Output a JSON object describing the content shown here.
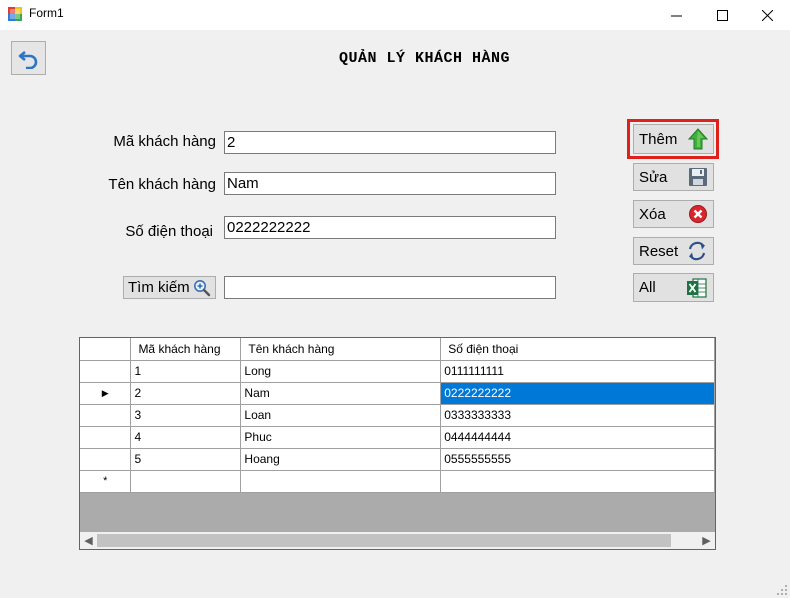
{
  "window": {
    "title": "Form1"
  },
  "heading": "QUẢN LÝ KHÁCH HÀNG",
  "form": {
    "ma_label": "Mã khách hàng",
    "ma_value": "2",
    "ten_label": "Tên khách hàng",
    "ten_value": "Nam",
    "sdt_label": "Số điện thoại",
    "sdt_value": "0222222222",
    "search_button": "Tìm kiếm",
    "search_value": ""
  },
  "buttons": {
    "add": "Thêm",
    "edit": "Sửa",
    "delete": "Xóa",
    "reset": "Reset",
    "all": "All"
  },
  "grid": {
    "columns": [
      "Mã khách hàng",
      "Tên khách hàng",
      "Số điện thoại"
    ],
    "rows": [
      [
        "1",
        "Long",
        "0111111111"
      ],
      [
        "2",
        "Nam",
        "0222222222"
      ],
      [
        "3",
        "Loan",
        "0333333333"
      ],
      [
        "4",
        "Phuc",
        "0444444444"
      ],
      [
        "5",
        "Hoang",
        "0555555555"
      ]
    ],
    "current_row_marker": "▶",
    "new_row_marker": "*"
  },
  "colors": {
    "highlight": "#e0201b",
    "selection": "#0078d7"
  },
  "icons": {
    "app": "form-app-icon",
    "back": "undo-arrow-icon",
    "add": "green-up-arrow-icon",
    "edit": "floppy-disk-icon",
    "delete": "red-x-circle-icon",
    "reset": "refresh-icon",
    "all": "excel-icon",
    "search": "magnifier-plus-icon"
  }
}
